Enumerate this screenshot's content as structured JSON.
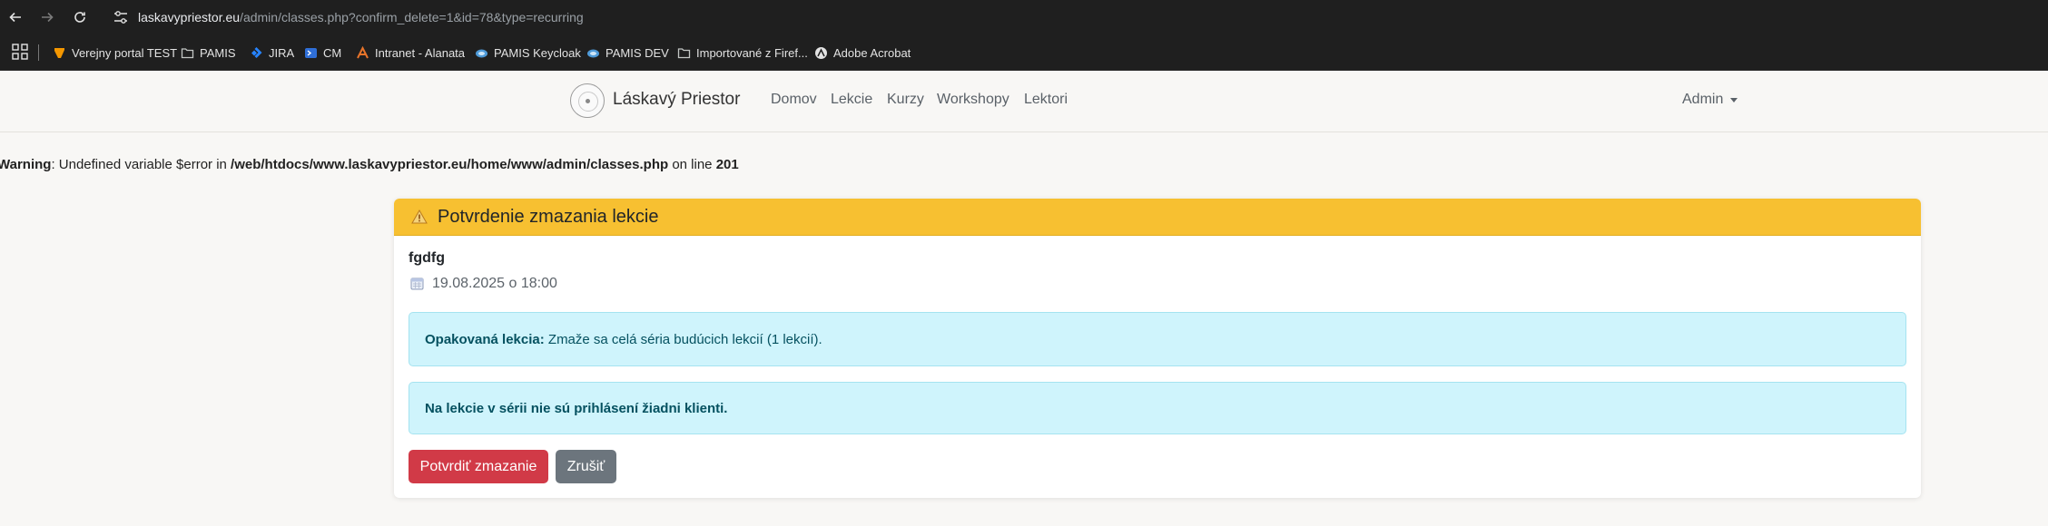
{
  "browser": {
    "url_host": "laskavypriestor.eu",
    "url_path": "/admin/classes.php?confirm_delete=1&id=78&type=recurring",
    "bookmarks": [
      {
        "label": "Verejny portal TEST",
        "icon": "typo3-icon",
        "color": "#f49700"
      },
      {
        "label": "PAMIS",
        "icon": "folder-icon",
        "color": "#c4c7c5"
      },
      {
        "label": "JIRA",
        "icon": "jira-icon",
        "color": "#2684ff"
      },
      {
        "label": "CM",
        "icon": "cm-icon",
        "color": "#2f6fd8"
      },
      {
        "label": "Intranet - Alanata",
        "icon": "alanata-icon",
        "color": "#e8742a"
      },
      {
        "label": "PAMIS Keycloak",
        "icon": "cloud-icon",
        "color": "#4f9bd9"
      },
      {
        "label": "PAMIS DEV",
        "icon": "cloud-icon",
        "color": "#4f9bd9"
      },
      {
        "label": "Importované z Firef...",
        "icon": "folder-icon",
        "color": "#c4c7c5"
      },
      {
        "label": "Adobe Acrobat",
        "icon": "acrobat-icon",
        "color": "#e3e3e3"
      }
    ]
  },
  "site": {
    "brand": "Láskavý Priestor",
    "nav": [
      "Domov",
      "Lekcie",
      "Kurzy",
      "Workshopy",
      "Lektori"
    ],
    "user_menu": "Admin"
  },
  "warning": {
    "label": "Warning",
    "message": ": Undefined variable $error in ",
    "path": "/web/htdocs/www.laskavypriestor.eu/home/www/admin/classes.php",
    "on_line": " on line ",
    "line": "201"
  },
  "card": {
    "title": "Potvrdenie zmazania lekcie",
    "lesson_name": "fgdfg",
    "lesson_date": "19.08.2025 o 18:00",
    "recurring_label": "Opakovaná lekcia:",
    "recurring_text": " Zmaže sa celá séria budúcich lekcií (1 lekcií).",
    "no_clients_text": "Na lekcie v sérii nie sú prihlásení žiadni klienti.",
    "confirm_button": "Potvrdiť zmazanie",
    "cancel_button": "Zrušiť",
    "header_color": "#f7c031",
    "danger_color": "#d13a47"
  }
}
